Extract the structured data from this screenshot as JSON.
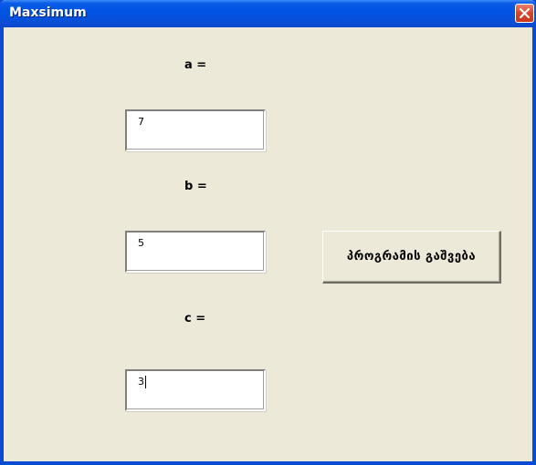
{
  "window": {
    "title": "Maxsimum"
  },
  "fields": {
    "a_label": "a =",
    "a_value": "7",
    "b_label": "b =",
    "b_value": "5",
    "c_label": "c =",
    "c_value": "3"
  },
  "run_button": {
    "label": "პროგრამის გაშვება"
  },
  "icons": {
    "close": "close-icon"
  },
  "colors": {
    "titlebar": "#0054e3",
    "close_button": "#d9442a",
    "background": "#ece9d8"
  }
}
